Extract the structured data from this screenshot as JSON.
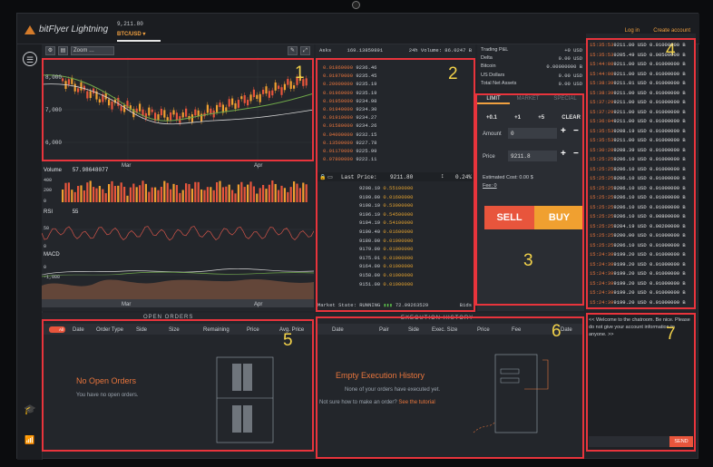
{
  "header": {
    "logo_text": "bitFlyer Lightning",
    "price": "9,211.80",
    "pair": "BTC/USD ▾",
    "login": "Log in",
    "create_account": "Create account"
  },
  "chart": {
    "zoom_label": "Zoom …",
    "y_labels": [
      "8,000",
      "7,000",
      "6,000"
    ],
    "x_labels": [
      "Mar",
      "Apr"
    ],
    "volume_label": "Volume",
    "volume_value": "57.98648077",
    "volume_ticks": [
      "400",
      "200",
      "0"
    ],
    "rsi_label": "RSI",
    "rsi_value": "55",
    "rsi_ticks": [
      "50",
      "0"
    ],
    "macd_label": "MACD",
    "macd_ticks": [
      "0",
      "-1,000"
    ],
    "bottom_x_labels": [
      "Mar",
      "Apr"
    ]
  },
  "orderbook": {
    "header_asks": "Asks",
    "header_asks_value": "169.13859891",
    "header_volume": "24h Volume: 86.0247 B",
    "asks": [
      [
        "0.01860000",
        "9236.46"
      ],
      [
        "0.01970000",
        "9235.45"
      ],
      [
        "0.20000000",
        "9235.19"
      ],
      [
        "0.01960000",
        "9235.19"
      ],
      [
        "0.01950000",
        "9234.98"
      ],
      [
        "0.01940000",
        "9234.30"
      ],
      [
        "0.01910000",
        "9234.27"
      ],
      [
        "0.01580000",
        "9234.26"
      ],
      [
        "0.04000000",
        "9232.15"
      ],
      [
        "0.13500000",
        "9227.78"
      ],
      [
        "0.01170000",
        "9225.99"
      ],
      [
        "0.07800000",
        "9222.11"
      ]
    ],
    "last_price_label": "Last Price:",
    "last_price": "9211.80",
    "spread": "0.24%",
    "bids": [
      [
        "9208.19",
        "0.55100000"
      ],
      [
        "9199.00",
        "0.01600000"
      ],
      [
        "9198.10",
        "0.53000000"
      ],
      [
        "9196.19",
        "0.54500000"
      ],
      [
        "9194.19",
        "0.54100000"
      ],
      [
        "9190.40",
        "0.01600000"
      ],
      [
        "9180.00",
        "0.01000000"
      ],
      [
        "9179.00",
        "0.01000000"
      ],
      [
        "9175.01",
        "0.01000000"
      ],
      [
        "9164.00",
        "0.01000000"
      ],
      [
        "9158.00",
        "0.01000000"
      ],
      [
        "9151.00",
        "0.01000000"
      ]
    ],
    "market_state": "Market State: RUNNING",
    "market_vol": "72.09263529",
    "bids_label": "Bids"
  },
  "summary": {
    "rows": [
      [
        "Trading P&L",
        "+0 USD"
      ],
      [
        "Delta",
        "0.00 USD"
      ],
      [
        "Bitcoin",
        "0.00000000 B"
      ],
      [
        "US Dollars",
        "0.00 USD"
      ],
      [
        "Total Net Assets",
        "0.00 USD"
      ]
    ]
  },
  "order_form": {
    "tabs": [
      "LIMIT",
      "MARKET",
      "SPECIAL"
    ],
    "qty_buttons": [
      "+0.1",
      "+1",
      "+5",
      "CLEAR"
    ],
    "amount_label": "Amount",
    "amount_value": "0",
    "price_label": "Price",
    "price_value": "9211.8",
    "estimated_cost": "Estimated Cost: 0.00 $",
    "fee": "Fee: 0",
    "sell": "SELL",
    "buy": "BUY"
  },
  "trades": [
    [
      "15:35:53",
      "9211.80",
      "USD",
      "0.01000000",
      "B"
    ],
    [
      "15:35:53",
      "9205.49",
      "USD",
      "0.00500000",
      "B"
    ],
    [
      "15:44:08",
      "9211.80",
      "USD",
      "0.01000000",
      "B"
    ],
    [
      "15:44:08",
      "9211.80",
      "USD",
      "0.01000000",
      "B"
    ],
    [
      "15:38:39",
      "9211.81",
      "USD",
      "0.01000000",
      "B"
    ],
    [
      "15:38:39",
      "9211.80",
      "USD",
      "0.01000000",
      "B"
    ],
    [
      "15:37:29",
      "9211.80",
      "USD",
      "0.01000000",
      "B"
    ],
    [
      "15:37:29",
      "9211.80",
      "USD",
      "0.01000000",
      "B"
    ],
    [
      "15:36:04",
      "9211.80",
      "USD",
      "0.01000000",
      "B"
    ],
    [
      "15:35:53",
      "9208.19",
      "USD",
      "0.01000000",
      "B"
    ],
    [
      "15:35:53",
      "9211.80",
      "USD",
      "0.01000000",
      "B"
    ],
    [
      "15:30:28",
      "9208.39",
      "USD",
      "0.01000000",
      "B"
    ],
    [
      "15:25:25",
      "9206.10",
      "USD",
      "0.01000000",
      "B"
    ],
    [
      "15:25:25",
      "9206.10",
      "USD",
      "0.01000000",
      "B"
    ],
    [
      "15:25:25",
      "9206.10",
      "USD",
      "0.01000000",
      "B"
    ],
    [
      "15:25:25",
      "9206.10",
      "USD",
      "0.01000000",
      "B"
    ],
    [
      "15:25:25",
      "9206.10",
      "USD",
      "0.01000000",
      "B"
    ],
    [
      "15:25:25",
      "9206.10",
      "USD",
      "0.01000000",
      "B"
    ],
    [
      "15:25:25",
      "9206.10",
      "USD",
      "0.00800000",
      "B"
    ],
    [
      "15:25:25",
      "9204.19",
      "USD",
      "0.00200000",
      "B"
    ],
    [
      "15:25:25",
      "9200.00",
      "USD",
      "0.01000000",
      "B"
    ],
    [
      "15:25:25",
      "9206.10",
      "USD",
      "0.01000000",
      "B"
    ],
    [
      "15:24:39",
      "9199.20",
      "USD",
      "0.01000000",
      "B"
    ],
    [
      "15:24:39",
      "9199.20",
      "USD",
      "0.01000000",
      "B"
    ],
    [
      "15:24:39",
      "9199.20",
      "USD",
      "0.01000000",
      "B"
    ],
    [
      "15:24:39",
      "9199.20",
      "USD",
      "0.01000000",
      "B"
    ],
    [
      "15:24:39",
      "9199.20",
      "USD",
      "0.01000000",
      "B"
    ],
    [
      "15:24:39",
      "9199.20",
      "USD",
      "0.01000000",
      "B"
    ]
  ],
  "open_orders": {
    "title": "OPEN ORDERS",
    "all_toggle": "All",
    "headers": [
      "Date",
      "Order Type",
      "Side",
      "Size",
      "Remaining",
      "Price",
      "Avg. Price"
    ],
    "empty_title": "No Open Orders",
    "empty_sub": "You have no open orders."
  },
  "execution_history": {
    "title": "EXECUTION HISTORY",
    "headers": [
      "Date",
      "Pair",
      "Side",
      "Exec. Size",
      "Price",
      "Fee",
      "Date"
    ],
    "empty_title": "Empty Execution History",
    "empty_sub": "None of your orders have executed yet.",
    "howto_prefix": "Not sure how to make an order?",
    "howto_link": "See the tutorial"
  },
  "chat": {
    "welcome": "<< Welcome to the chatroom. Be nice. Please do not give your account information to anyone. >>",
    "send": "SEND"
  },
  "annotations": [
    "1",
    "2",
    "3",
    "4",
    "5",
    "6",
    "7"
  ],
  "colors": {
    "accent": "#f0a040",
    "sell": "#e8553c",
    "buy": "#f0a030",
    "annotation": "#e8343c",
    "label": "#f2d24a"
  }
}
